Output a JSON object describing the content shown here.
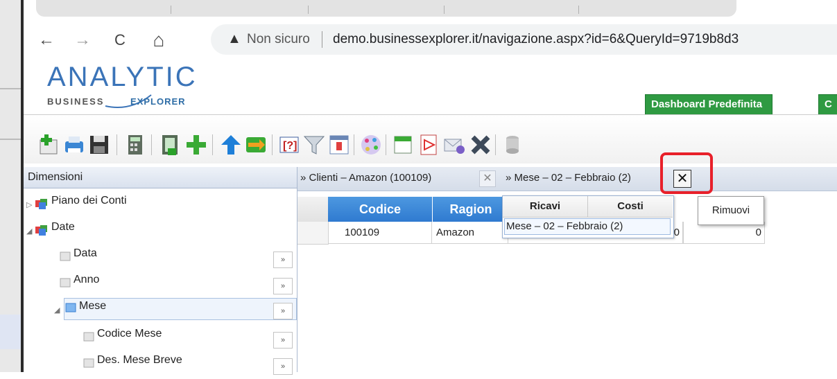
{
  "browser": {
    "security_label": "Non sicuro",
    "url": "demo.businessexplorer.it/navigazione.aspx?id=6&QueryId=9719b8d3",
    "back_glyph": "←",
    "forward_glyph": "→",
    "reload_glyph": "C",
    "home_glyph": "⌂",
    "warning_glyph": "▲"
  },
  "logo": {
    "main": "ANALYTIC",
    "business": "BUSINESS",
    "explorer": "EXPLORER"
  },
  "app_tabs": [
    {
      "label": "Dashboard Predefinita"
    },
    {
      "label": "C"
    }
  ],
  "toolbar": {
    "icons": [
      "new-icon",
      "print-icon",
      "save-icon",
      "calculator-icon",
      "export-excel-icon",
      "add-icon",
      "up-arrow-icon",
      "swap-icon",
      "help-icon",
      "filter-icon",
      "report-icon",
      "color-icon",
      "calendar-icon",
      "pdf-icon",
      "email-icon",
      "delete-icon",
      "database-icon"
    ]
  },
  "dimensions": {
    "title": "Dimensioni",
    "items": [
      {
        "label": "Piano dei Conti",
        "expand": ""
      },
      {
        "label": "Date",
        "expand": ""
      },
      {
        "label": "Data",
        "expand": "»"
      },
      {
        "label": "Anno",
        "expand": "»"
      },
      {
        "label": "Mese",
        "expand": "»"
      },
      {
        "label": "Codice Mese",
        "expand": "»"
      },
      {
        "label": "Des. Mese Breve",
        "expand": "»"
      }
    ]
  },
  "filters": {
    "crumb1": "» Clienti – Amazon (100109)",
    "crumb2": "» Mese – 02 – Febbraio (2)",
    "clear_glyph": "✕",
    "clear_glyph_2": "✕"
  },
  "grid": {
    "headers": [
      "Codice",
      "Ragion"
    ],
    "row": {
      "codice": "100109",
      "ragione": "Amazon",
      "val_a": "0",
      "val_b": "0"
    }
  },
  "popup": {
    "headers": [
      "Ricavi",
      "Costi"
    ],
    "item": "Mese – 02 – Febbraio (2)"
  },
  "tooltip": {
    "text": "Rimuovi"
  },
  "colors": {
    "tab_green": "#2f9a42",
    "grid_header_blue": "#3c88d8",
    "highlight_red": "#e8202a",
    "logo_blue": "#3b74b8"
  }
}
